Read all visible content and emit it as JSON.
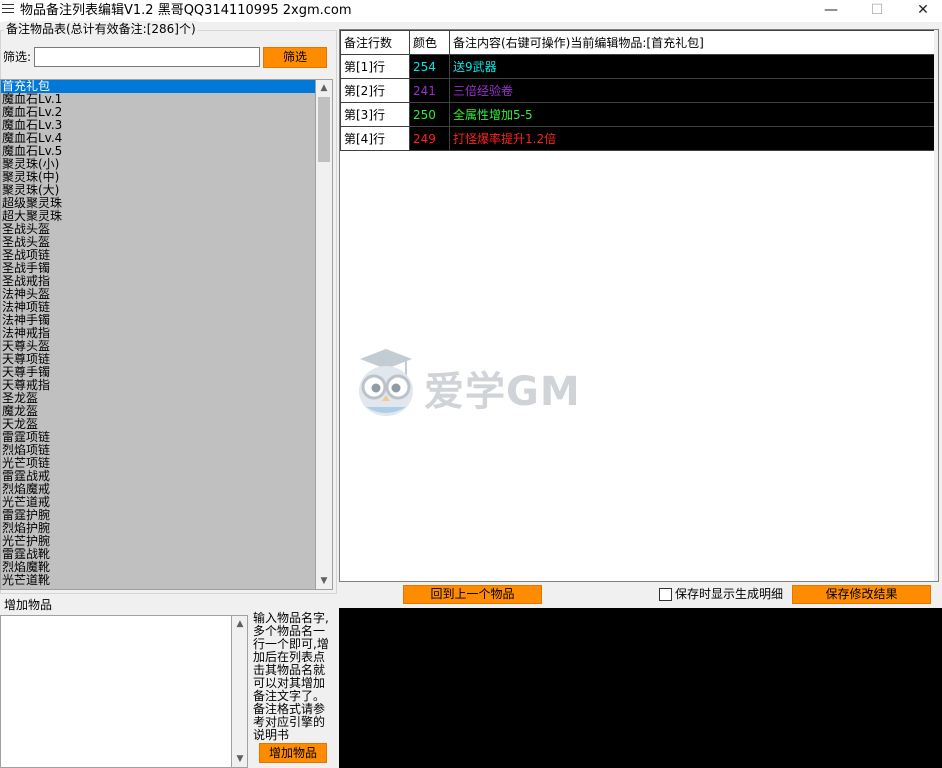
{
  "window": {
    "title": "物品备注列表编辑V1.2 黑哥QQ314110995  2xgm.com",
    "minimize": "—",
    "maximize": "☐",
    "close": "✕"
  },
  "items_group": {
    "legend": "备注物品表(总计有效备注:[286]个)",
    "filter_label": "筛选:",
    "filter_value": "",
    "filter_button": "筛选",
    "items": [
      "首充礼包",
      "魔血石Lv.1",
      "魔血石Lv.2",
      "魔血石Lv.3",
      "魔血石Lv.4",
      "魔血石Lv.5",
      "聚灵珠(小)",
      "聚灵珠(中)",
      "聚灵珠(大)",
      "超级聚灵珠",
      "超大聚灵珠",
      "圣战头盔",
      "圣战头盔",
      "圣战项链",
      "圣战手镯",
      "圣战戒指",
      "法神头盔",
      "法神项链",
      "法神手镯",
      "法神戒指",
      "天尊头盔",
      "天尊项链",
      "天尊手镯",
      "天尊戒指",
      "圣龙盔",
      "魔龙盔",
      "天龙盔",
      "雷霆项链",
      "烈焰项链",
      "光芒项链",
      "雷霆战戒",
      "烈焰魔戒",
      "光芒道戒",
      "雷霆护腕",
      "烈焰护腕",
      "光芒护腕",
      "雷霆战靴",
      "烈焰魔靴",
      "光芒道靴"
    ],
    "selected_index": 0
  },
  "add_group": {
    "legend": "增加物品",
    "textarea_value": "",
    "help_text": "输入物品名字,多个物品名一行一个即可,增加后在列表点击其物品名就可以对其增加备注文字了。备注格式请参考对应引擎的说明书",
    "add_button": "增加物品"
  },
  "grid": {
    "headers": [
      "备注行数",
      "颜色",
      "备注内容(右键可操作)当前编辑物品:[首充礼包]"
    ],
    "rows": [
      {
        "line": "第[1]行",
        "color_code": "254",
        "text": "送9武器",
        "color": "#00e5e5"
      },
      {
        "line": "第[2]行",
        "color_code": "241",
        "text": "三倍经验卷",
        "color": "#9b30d0"
      },
      {
        "line": "第[3]行",
        "color_code": "250",
        "text": "全属性增加5-5",
        "color": "#33ee33"
      },
      {
        "line": "第[4]行",
        "color_code": "249",
        "text": "打怪爆率提升1.2倍",
        "color": "#ff2020"
      }
    ]
  },
  "watermark": {
    "text": "爱学GM"
  },
  "controls": {
    "prev_button": "回到上一个物品",
    "show_detail_label": "保存时显示生成明细",
    "show_detail_checked": false,
    "save_button": "保存修改结果"
  }
}
